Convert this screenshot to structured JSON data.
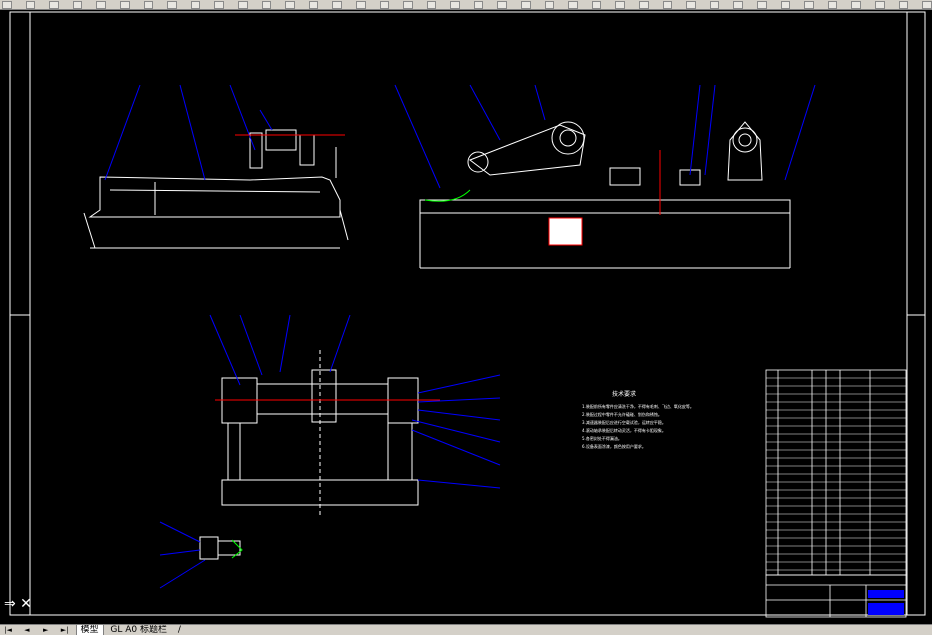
{
  "toolbar": {
    "button_count": 40
  },
  "drawing": {
    "line_color": "#ffffff",
    "border_color": "#ffffff",
    "part_color": "#0000ff",
    "annotation_color": "#ffffff",
    "accent_red": "#ff0000",
    "accent_green": "#00ff00",
    "leader_color": "#0000ff",
    "notes_title": "技术要求",
    "notes_lines": [
      "1.装配前所有零件应清洗干净，不得有毛刺、飞边、氧化皮等。",
      "2.装配过程中零件不允许磕碰、划伤和锈蚀。",
      "3.减速器装配后应进行空载试验，运转应平稳。",
      "4.滚动轴承装配后转动灵活，不得有卡阻现象。",
      "5.各密封处不得漏油。",
      "6.设备表面涂漆，颜色按用户要求。"
    ]
  },
  "ucs_icon": "ucs-axis-icon",
  "tabs": {
    "nav_first": "|◄",
    "nav_prev": "◄",
    "nav_next": "►",
    "nav_last": "►|",
    "model": "模型",
    "layout1": "GL A0 标题栏",
    "layout_extra": "/"
  }
}
